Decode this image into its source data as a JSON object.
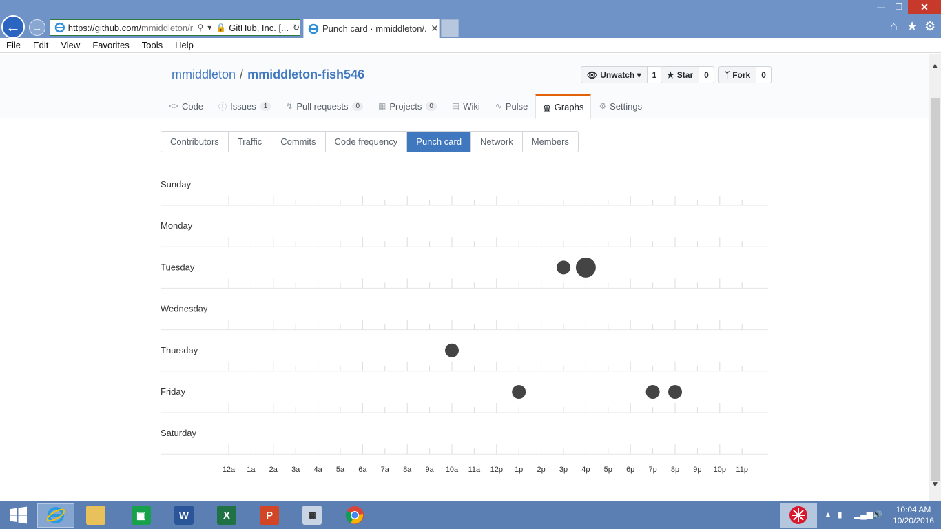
{
  "browser": {
    "address": {
      "url_host": "https://github.com/",
      "url_path": "mmiddleton/r",
      "site_name": "GitHub, Inc. [..."
    },
    "tab": {
      "title": "Punch card · mmiddleton/..."
    },
    "menu": [
      "File",
      "Edit",
      "View",
      "Favorites",
      "Tools",
      "Help"
    ]
  },
  "repo": {
    "owner": "mmiddleton",
    "separator": "/",
    "name": "mmiddleton-fish546",
    "actions": {
      "watch": {
        "label": "Unwatch",
        "count": "1"
      },
      "star": {
        "label": "Star",
        "count": "0"
      },
      "fork": {
        "label": "Fork",
        "count": "0"
      }
    },
    "nav": [
      {
        "label": "Code",
        "icon": "code-icon",
        "count": ""
      },
      {
        "label": "Issues",
        "icon": "issue-icon",
        "count": "1"
      },
      {
        "label": "Pull requests",
        "icon": "pull-request-icon",
        "count": "0"
      },
      {
        "label": "Projects",
        "icon": "project-icon",
        "count": "0"
      },
      {
        "label": "Wiki",
        "icon": "book-icon",
        "count": ""
      },
      {
        "label": "Pulse",
        "icon": "pulse-icon",
        "count": ""
      },
      {
        "label": "Graphs",
        "icon": "graph-icon",
        "count": "",
        "selected": true
      },
      {
        "label": "Settings",
        "icon": "gear-icon",
        "count": ""
      }
    ]
  },
  "graphs_nav": [
    {
      "label": "Contributors"
    },
    {
      "label": "Traffic"
    },
    {
      "label": "Commits"
    },
    {
      "label": "Code frequency"
    },
    {
      "label": "Punch card",
      "selected": true
    },
    {
      "label": "Network"
    },
    {
      "label": "Members"
    }
  ],
  "chart_data": {
    "type": "scatter",
    "days": [
      "Sunday",
      "Monday",
      "Tuesday",
      "Wednesday",
      "Thursday",
      "Friday",
      "Saturday"
    ],
    "hours": [
      "12a",
      "1a",
      "2a",
      "3a",
      "4a",
      "5a",
      "6a",
      "7a",
      "8a",
      "9a",
      "10a",
      "11a",
      "12p",
      "1p",
      "2p",
      "3p",
      "4p",
      "5p",
      "6p",
      "7p",
      "8p",
      "9p",
      "10p",
      "11p"
    ],
    "points": [
      {
        "day": "Tuesday",
        "hour": "3p",
        "commits": 1
      },
      {
        "day": "Tuesday",
        "hour": "4p",
        "commits": 2
      },
      {
        "day": "Thursday",
        "hour": "10a",
        "commits": 1
      },
      {
        "day": "Friday",
        "hour": "1p",
        "commits": 1
      },
      {
        "day": "Friday",
        "hour": "7p",
        "commits": 1
      },
      {
        "day": "Friday",
        "hour": "8p",
        "commits": 1
      }
    ],
    "dot_color": "#444444"
  },
  "taskbar": {
    "time": "10:04 AM",
    "date": "10/20/2016"
  }
}
